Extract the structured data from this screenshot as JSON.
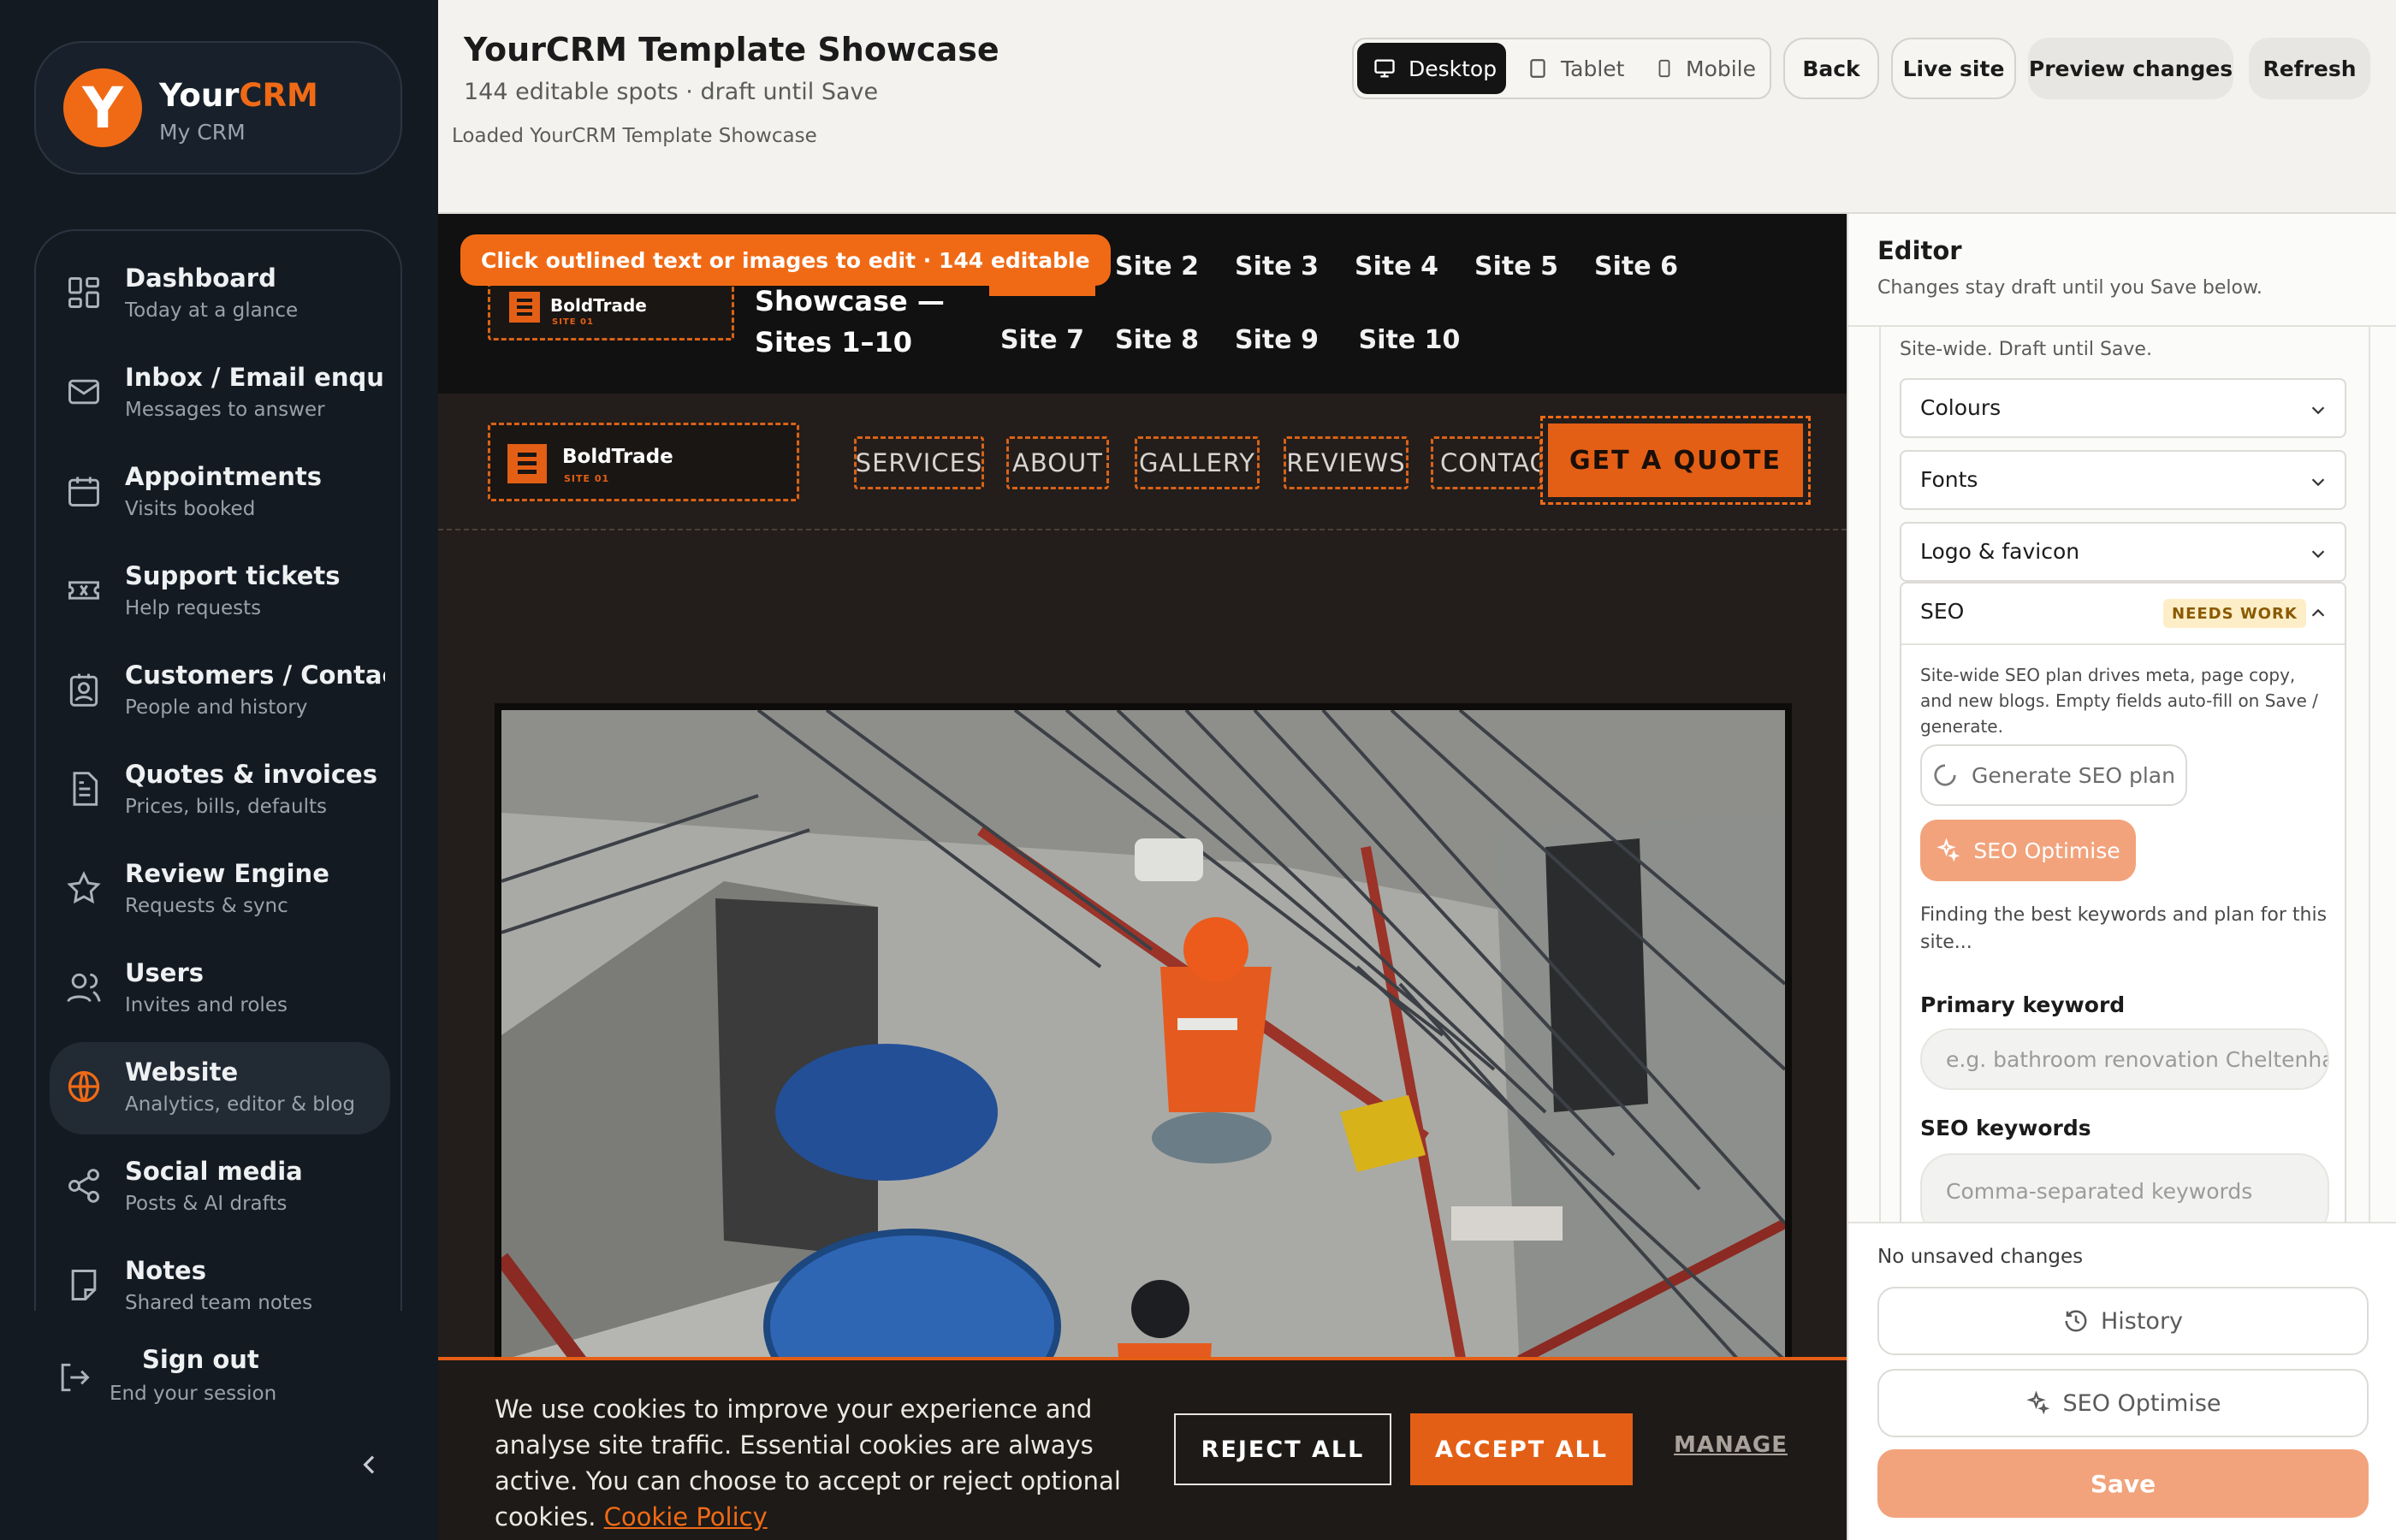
{
  "brand": {
    "name_primary": "Your",
    "name_accent": "CRM",
    "subtitle": "My CRM",
    "logo_letter": "Y"
  },
  "sidebar": {
    "items": [
      {
        "label": "Dashboard",
        "sub": "Today at a glance",
        "icon": "dashboard-grid-icon"
      },
      {
        "label": "Inbox / Email enquiries",
        "sub": "Messages to answer",
        "icon": "mail-icon"
      },
      {
        "label": "Appointments",
        "sub": "Visits booked",
        "icon": "calendar-icon"
      },
      {
        "label": "Support tickets",
        "sub": "Help requests",
        "icon": "ticket-icon"
      },
      {
        "label": "Customers / Contact",
        "sub": "People and history",
        "icon": "contact-book-icon"
      },
      {
        "label": "Quotes & invoices",
        "sub": "Prices, bills, defaults",
        "icon": "document-icon"
      },
      {
        "label": "Review Engine",
        "sub": "Requests & sync",
        "icon": "star-icon"
      },
      {
        "label": "Users",
        "sub": "Invites and roles",
        "icon": "users-icon"
      },
      {
        "label": "Website",
        "sub": "Analytics, editor & blog",
        "icon": "globe-icon",
        "active": true
      },
      {
        "label": "Social media",
        "sub": "Posts & AI drafts",
        "icon": "share-icon"
      },
      {
        "label": "Notes",
        "sub": "Shared team notes",
        "icon": "note-icon"
      }
    ],
    "signout": {
      "label": "Sign out",
      "sub": "End your session"
    }
  },
  "header": {
    "title": "YourCRM Template Showcase",
    "subtitle": "144 editable spots · draft until Save",
    "status": "Loaded YourCRM Template Showcase",
    "devices": [
      "Desktop",
      "Tablet",
      "Mobile"
    ],
    "active_device": "Desktop",
    "buttons": {
      "back": "Back",
      "live": "Live site",
      "preview": "Preview changes",
      "refresh": "Refresh"
    }
  },
  "preview": {
    "edit_hint": "Click outlined text or images to edit · 144 editable",
    "showcase_title": "Showcase — Sites 1–10",
    "site_tabs": [
      "Site 1",
      "Site 2",
      "Site 3",
      "Site 4",
      "Site 5",
      "Site 6",
      "Site 7",
      "Site 8",
      "Site 9",
      "Site 10"
    ],
    "active_tab": "Site 1",
    "logo_text": "BoldTrade",
    "logo_sub": "SITE 01",
    "nav_links": [
      "SERVICES",
      "ABOUT",
      "GALLERY",
      "REVIEWS",
      "CONTACT"
    ],
    "cta": "GET A QUOTE",
    "cookie": {
      "text": "We use cookies to improve your experience and analyse site traffic. Essential cookies are always active. You can choose to accept or reject optional cookies.",
      "link": "Cookie Policy",
      "reject": "REJECT ALL",
      "accept": "ACCEPT ALL",
      "manage": "MANAGE"
    }
  },
  "editor": {
    "title": "Editor",
    "subtitle": "Changes stay draft until you Save below.",
    "sitewide_note": "Site-wide. Draft until Save.",
    "sections": [
      "Colours",
      "Fonts",
      "Logo & favicon"
    ],
    "seo": {
      "label": "SEO",
      "badge": "NEEDS WORK",
      "description": "Site-wide SEO plan drives meta, page copy, and new blogs. Empty fields auto-fill on Save / generate.",
      "generate": "Generate SEO plan",
      "optimise": "SEO Optimise",
      "finding": "Finding the best keywords and plan for this site...",
      "primary_label": "Primary keyword",
      "primary_placeholder": "e.g. bathroom renovation Cheltenham",
      "keywords_label": "SEO keywords",
      "keywords_placeholder": "Comma-separated keywords"
    },
    "footer": {
      "unsaved": "No unsaved changes",
      "history": "History",
      "optimise": "SEO Optimise",
      "save": "Save"
    }
  },
  "colors": {
    "accent": "#f06a16",
    "sidebar_bg": "#131a22",
    "preview_bg": "#231e1b",
    "save_disabled": "#f2a37c"
  }
}
